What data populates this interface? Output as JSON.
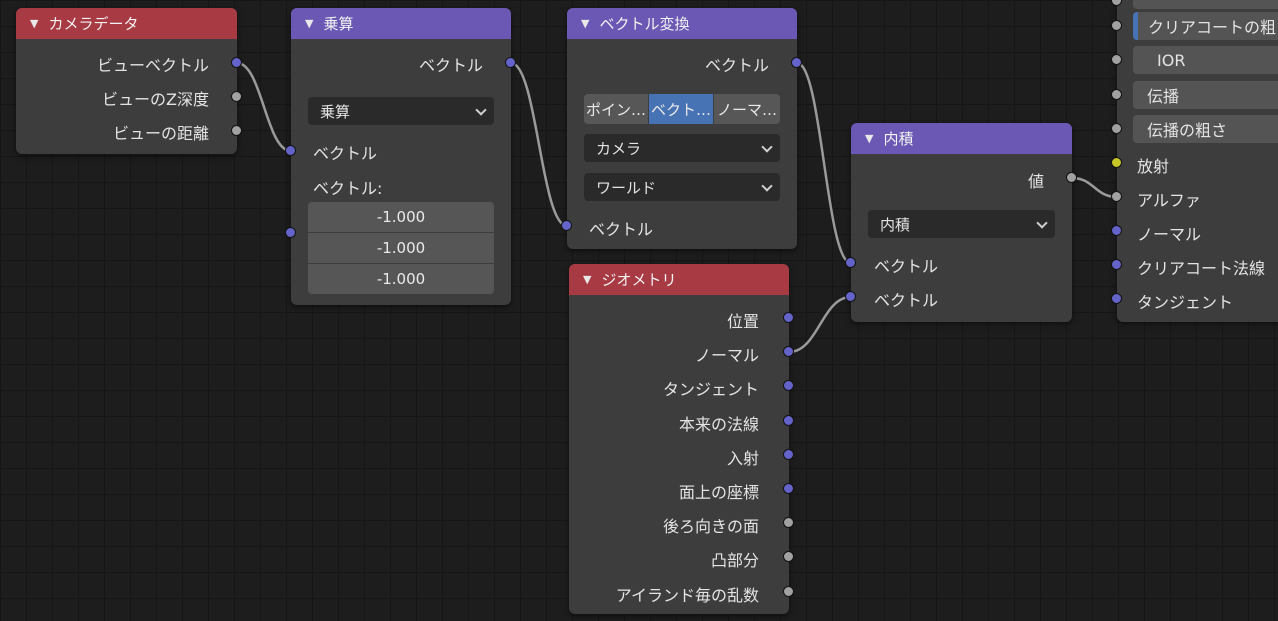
{
  "camera_data_node": {
    "title": "カメラデータ",
    "outputs": [
      "ビューベクトル",
      "ビューのZ深度",
      "ビューの距離"
    ]
  },
  "multiply_node": {
    "title": "乗算",
    "output": "ベクトル",
    "operation": "乗算",
    "input_label": "ベクトル",
    "vector_label": "ベクトル:",
    "values": [
      "-1.000",
      "-1.000",
      "-1.000"
    ]
  },
  "vector_transform_node": {
    "title": "ベクトル変換",
    "output": "ベクトル",
    "type_options": [
      "ポイン…",
      "ベクト…",
      "ノーマ…"
    ],
    "type_selected": "ベクト…",
    "convert_from": "カメラ",
    "convert_to": "ワールド",
    "input_label": "ベクトル"
  },
  "geometry_node": {
    "title": "ジオメトリ",
    "outputs": [
      "位置",
      "ノーマル",
      "タンジェント",
      "本来の法線",
      "入射",
      "面上の座標",
      "後ろ向きの面",
      "凸部分",
      "アイランド毎の乱数"
    ]
  },
  "dot_product_node": {
    "title": "内積",
    "output": "値",
    "operation": "内積",
    "inputs": [
      "ベクトル",
      "ベクトル"
    ]
  },
  "bsdf_node": {
    "fields": [
      "クリアコートの粗さ",
      "IOR",
      "伝播",
      "伝播の粗さ"
    ],
    "inputs": [
      "放射",
      "アルファ",
      "ノーマル",
      "クリアコート法線",
      "タンジェント"
    ]
  },
  "colors": {
    "vector_socket": "#6363c9",
    "float_socket": "#a1a1a1",
    "color_socket": "#c7c729",
    "input_header": "#a83a44",
    "vector_header": "#6b58b4",
    "active_option": "#4772b3"
  }
}
